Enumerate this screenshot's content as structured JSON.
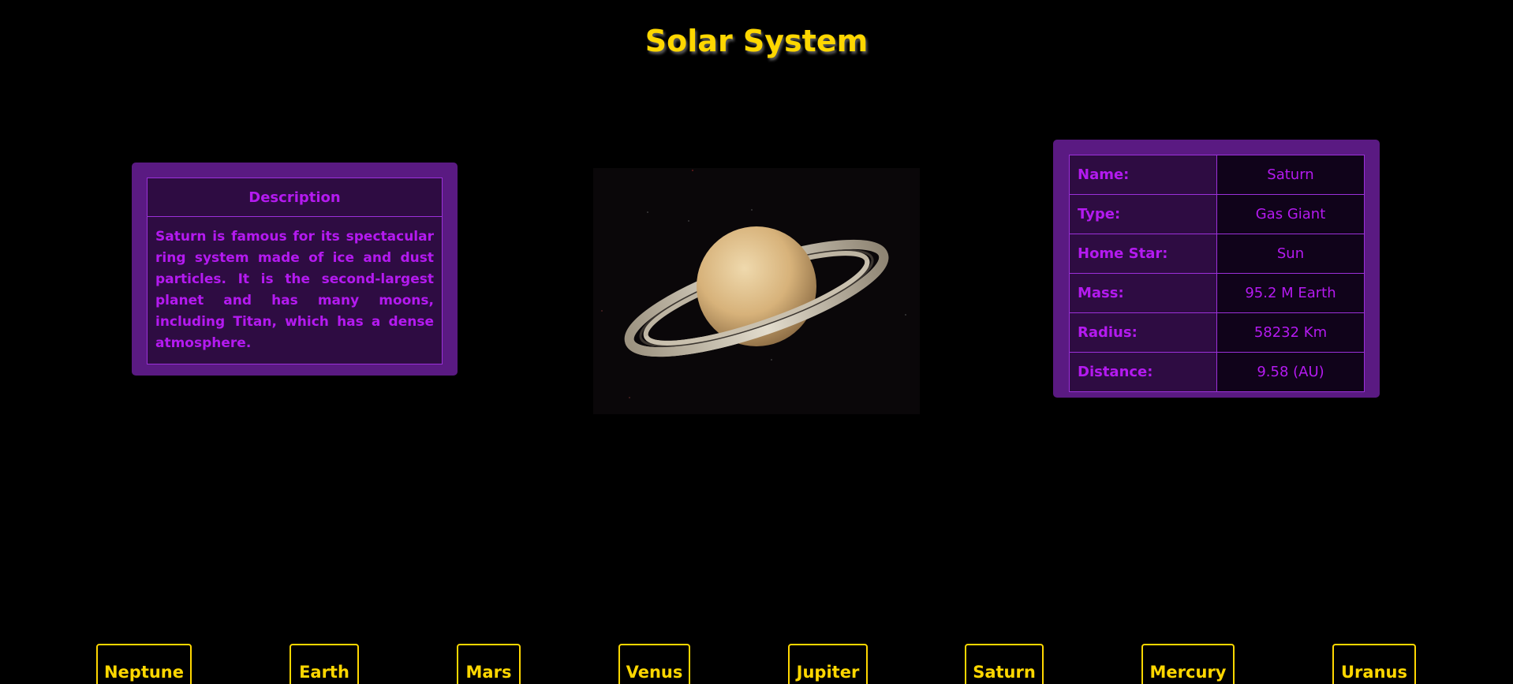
{
  "header": {
    "title": "Solar System"
  },
  "description": {
    "heading": "Description",
    "text": "Saturn is famous for its spectacular ring system made of ice and dust particles. It is the second-largest planet and has many moons, including Titan, which has a dense atmosphere."
  },
  "planet_info": {
    "rows": [
      {
        "label": "Name:",
        "value": "Saturn"
      },
      {
        "label": "Type:",
        "value": "Gas Giant"
      },
      {
        "label": "Home Star:",
        "value": "Sun"
      },
      {
        "label": "Mass:",
        "value": "95.2 M Earth"
      },
      {
        "label": "Radius:",
        "value": "58232 Km"
      },
      {
        "label": "Distance:",
        "value": "9.58 (AU)"
      }
    ]
  },
  "nav": {
    "buttons": [
      "Neptune",
      "Earth",
      "Mars",
      "Venus",
      "Jupiter",
      "Saturn",
      "Mercury",
      "Uranus"
    ]
  },
  "colors": {
    "title": "#ffd700",
    "card_bg": "#5a1a82",
    "card_text": "#b41af0",
    "nav_accent": "#ffd700"
  }
}
